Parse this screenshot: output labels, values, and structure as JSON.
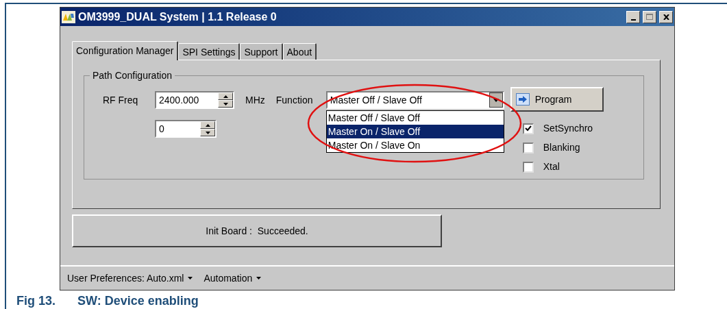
{
  "window": {
    "title": "OM3999_DUAL System | 1.1 Release 0"
  },
  "tabs": [
    {
      "label": "Configuration Manager",
      "selected": true
    },
    {
      "label": "SPI Settings",
      "selected": false
    },
    {
      "label": "Support",
      "selected": false
    },
    {
      "label": "About",
      "selected": false
    }
  ],
  "group": {
    "title": "Path Configuration"
  },
  "rf_freq": {
    "label": "RF Freq",
    "value": "2400.000",
    "unit": "MHz"
  },
  "spinner_2": {
    "value": "0"
  },
  "function": {
    "label": "Function",
    "value": "Master Off / Slave Off",
    "expanded": true,
    "options": [
      {
        "label": "Master Off / Slave Off",
        "highlighted": false
      },
      {
        "label": "Master On / Slave Off",
        "highlighted": true
      },
      {
        "label": "Master On / Slave On",
        "highlighted": false
      }
    ]
  },
  "program_button": {
    "label": "Program"
  },
  "checkboxes": [
    {
      "label": "SetSynchro",
      "checked": true
    },
    {
      "label": "Blanking",
      "checked": false
    },
    {
      "label": "Xtal",
      "checked": false
    }
  ],
  "status": {
    "text": "Init Board :  Succeeded."
  },
  "status_bar": [
    {
      "label": "User Preferences: Auto.xml"
    },
    {
      "label": "Automation"
    }
  ],
  "caption": {
    "number": "Fig 13.",
    "text": "SW: Device enabling"
  }
}
